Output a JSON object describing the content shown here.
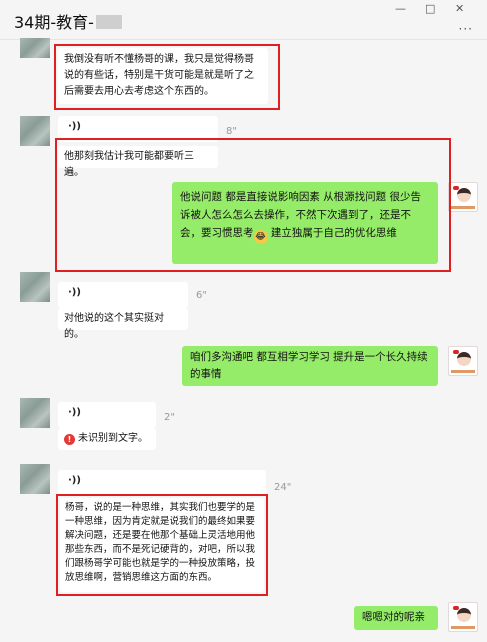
{
  "window": {
    "title": "34期-教育-",
    "min_icon": "—",
    "max_icon": "□",
    "close_icon": "✕",
    "more_icon": "···"
  },
  "messages": {
    "m1_text": "我倒没有听不懂杨哥的课，我只是觉得杨哥说的有些话，特别是干货可能是就是听了之后需要去用心去考虑这个东西的。",
    "m2_voice_icon": "·))",
    "m2_duration": "8\"",
    "m2_text": "他那刻我估计我可能都要听三遍。",
    "m3_text_a": "他说问题  都是直接说影响因素  从根源找问题  很少告诉被人怎么怎么去操作，不然下次遇到了，还是不会，要习惯思考",
    "m3_emoji": "😂",
    "m3_text_b": " 建立独属于自己的优化思维",
    "m4_voice_icon": "·))",
    "m4_duration": "6\"",
    "m4_text": "对他说的这个其实挺对的。",
    "m5_text": "咱们多沟通吧   都互相学习学习   提升是一个长久持续的事情",
    "m6_voice_icon": "·))",
    "m6_duration": "2\"",
    "m6_error_icon": "!",
    "m6_error": "未识别到文字。",
    "m7_voice_icon": "·))",
    "m7_duration": "24\"",
    "m7_text": "杨哥，说的是一种思维，其实我们也要学的是一种思维，因为肯定就是说我们的最终如果要解决问题，还是要在他那个基础上灵活地用他那些东西，而不是死记硬背的，对吧，所以我们跟杨哥学可能也就是学的一种投放策略，投放思维啊，营销思维这方面的东西。",
    "m8_text": "嗯嗯对的呢亲"
  },
  "colors": {
    "self_bubble": "#95ec69",
    "other_bubble": "#ffffff",
    "highlight_box": "#e02020",
    "error": "#e53935"
  }
}
